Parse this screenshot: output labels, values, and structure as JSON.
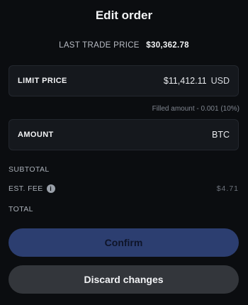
{
  "header": {
    "title": "Edit order"
  },
  "last_trade": {
    "label": "LAST TRADE PRICE",
    "value": "$30,362.78"
  },
  "limit_price": {
    "label": "LIMIT PRICE",
    "value": "$11,412.11",
    "unit": "USD"
  },
  "filled_note": "Filled amount - 0.001 (10%)",
  "amount": {
    "label": "AMOUNT",
    "unit": "BTC"
  },
  "summary": {
    "subtotal_label": "SUBTOTAL",
    "fee_label": "EST. FEE",
    "fee_value": "$4.71",
    "total_label": "TOTAL"
  },
  "icons": {
    "fee_info": "info-icon"
  },
  "buttons": {
    "confirm": "Confirm",
    "discard": "Discard changes"
  },
  "colors": {
    "background": "#0b0d10",
    "confirm_bg": "#2c3e70",
    "discard_bg": "#33363b"
  }
}
